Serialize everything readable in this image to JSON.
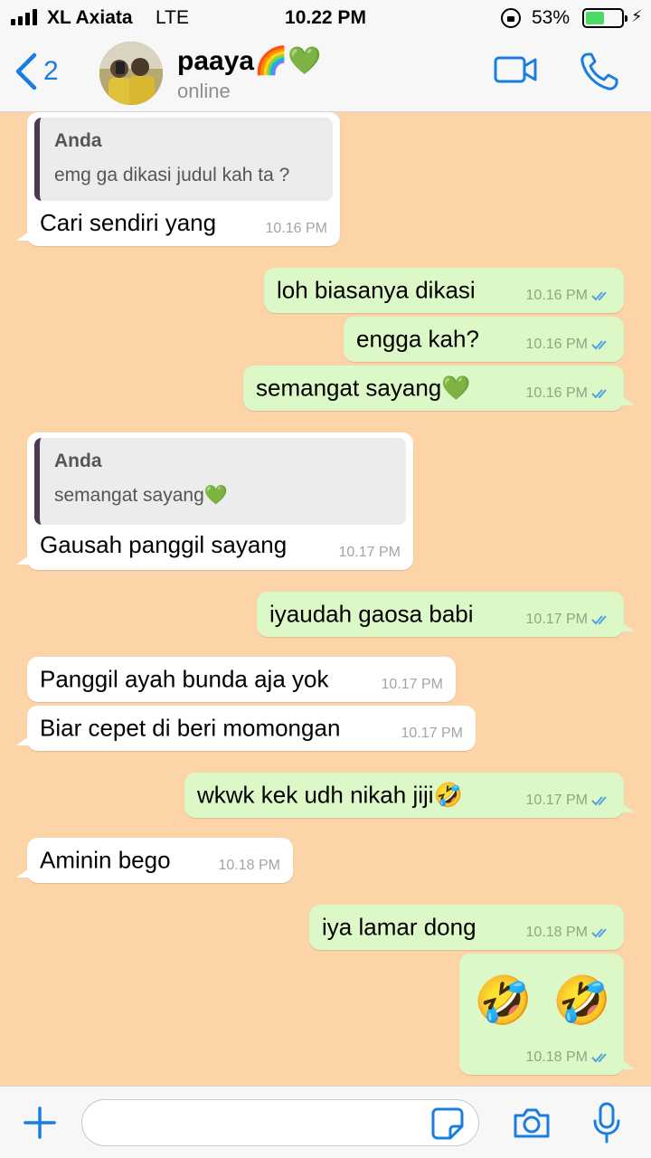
{
  "status_bar": {
    "carrier": "XL Axiata",
    "network": "LTE",
    "time": "10.22 PM",
    "battery_percent": "53%",
    "battery_level": 0.53,
    "charging_icon": "⚡"
  },
  "header": {
    "back_count": "2",
    "contact_name": "paaya🌈💚",
    "contact_status": "online"
  },
  "messages": [
    {
      "dir": "in",
      "quote_author": "Anda",
      "quote_text": "emg ga dikasi judul kah ta ?",
      "text": "Cari sendiri yang",
      "time": "10.16 PM"
    },
    {
      "dir": "out",
      "text": "loh biasanya dikasi",
      "time": "10.16 PM"
    },
    {
      "dir": "out",
      "text": "engga kah?",
      "time": "10.16 PM"
    },
    {
      "dir": "out",
      "text": "semangat sayang💚",
      "time": "10.16 PM"
    },
    {
      "dir": "in",
      "quote_author": "Anda",
      "quote_text": "semangat sayang💚",
      "text": "Gausah panggil sayang",
      "time": "10.17 PM"
    },
    {
      "dir": "out",
      "text": "iyaudah gaosa babi",
      "time": "10.17 PM"
    },
    {
      "dir": "in",
      "text": "Panggil ayah bunda aja yok",
      "time": "10.17 PM"
    },
    {
      "dir": "in",
      "text": "Biar cepet di beri momongan",
      "time": "10.17 PM"
    },
    {
      "dir": "out",
      "text": "wkwk kek udh nikah jiji🤣",
      "time": "10.17 PM"
    },
    {
      "dir": "in",
      "text": "Aminin bego",
      "time": "10.18 PM"
    },
    {
      "dir": "out",
      "text": "iya lamar dong",
      "time": "10.18 PM"
    },
    {
      "dir": "out",
      "text": "🤣 🤣",
      "time": "10.18 PM"
    }
  ],
  "input": {
    "placeholder": "",
    "icons": [
      "plus-icon",
      "sticker-icon",
      "camera-icon",
      "microphone-icon"
    ]
  },
  "colors": {
    "accent": "#1a7ee0",
    "wallpaper": "#fdd3a8",
    "outgoing_bubble": "#dcf8c6",
    "incoming_bubble": "#ffffff",
    "read_tick": "#4fa3e0"
  }
}
